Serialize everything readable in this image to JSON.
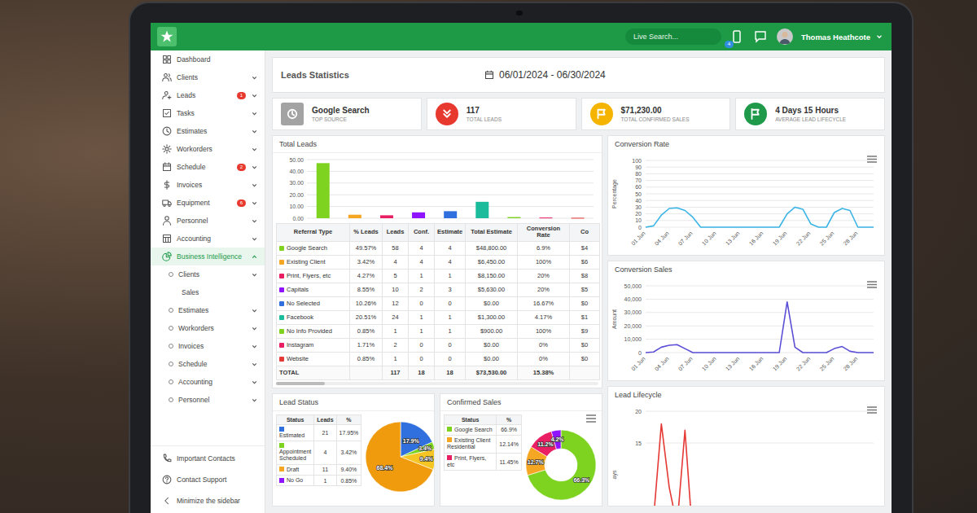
{
  "topbar": {
    "search_placeholder": "Live Search...",
    "phone_badge": "4",
    "user_name": "Thomas Heathcote"
  },
  "sidebar": {
    "items": [
      {
        "label": "Dashboard",
        "kind": "main",
        "badge": "",
        "expandable": false,
        "selected": false,
        "expanded": false
      },
      {
        "label": "Clients",
        "kind": "main",
        "badge": "",
        "expandable": true,
        "selected": false,
        "expanded": false
      },
      {
        "label": "Leads",
        "kind": "main",
        "badge": "1",
        "expandable": true,
        "selected": false,
        "expanded": false
      },
      {
        "label": "Tasks",
        "kind": "main",
        "badge": "",
        "expandable": true,
        "selected": false,
        "expanded": false
      },
      {
        "label": "Estimates",
        "kind": "main",
        "badge": "",
        "expandable": true,
        "selected": false,
        "expanded": false
      },
      {
        "label": "Workorders",
        "kind": "main",
        "badge": "",
        "expandable": true,
        "selected": false,
        "expanded": false
      },
      {
        "label": "Schedule",
        "kind": "main",
        "badge": "2",
        "expandable": true,
        "selected": false,
        "expanded": false
      },
      {
        "label": "Invoices",
        "kind": "main",
        "badge": "",
        "expandable": true,
        "selected": false,
        "expanded": false
      },
      {
        "label": "Equipment",
        "kind": "main",
        "badge": "6",
        "expandable": true,
        "selected": false,
        "expanded": false
      },
      {
        "label": "Personnel",
        "kind": "main",
        "badge": "",
        "expandable": true,
        "selected": false,
        "expanded": false
      },
      {
        "label": "Accounting",
        "kind": "main",
        "badge": "",
        "expandable": true,
        "selected": false,
        "expanded": false
      },
      {
        "label": "Business Intelligence",
        "kind": "main",
        "badge": "",
        "expandable": true,
        "selected": true,
        "expanded": true
      },
      {
        "label": "Clients",
        "kind": "sub",
        "badge": "",
        "expandable": true,
        "selected": false,
        "expanded": false
      },
      {
        "label": "Sales",
        "kind": "subsub",
        "badge": "",
        "expandable": false,
        "selected": false,
        "expanded": false
      },
      {
        "label": "Estimates",
        "kind": "sub",
        "badge": "",
        "expandable": true,
        "selected": false,
        "expanded": false
      },
      {
        "label": "Workorders",
        "kind": "sub",
        "badge": "",
        "expandable": true,
        "selected": false,
        "expanded": false
      },
      {
        "label": "Invoices",
        "kind": "sub",
        "badge": "",
        "expandable": true,
        "selected": false,
        "expanded": false
      },
      {
        "label": "Schedule",
        "kind": "sub",
        "badge": "",
        "expandable": true,
        "selected": false,
        "expanded": false
      },
      {
        "label": "Accounting",
        "kind": "sub",
        "badge": "",
        "expandable": true,
        "selected": false,
        "expanded": false
      },
      {
        "label": "Personnel",
        "kind": "sub",
        "badge": "",
        "expandable": true,
        "selected": false,
        "expanded": false
      }
    ],
    "footer": [
      {
        "label": "Important Contacts"
      },
      {
        "label": "Contact Support"
      },
      {
        "label": "Minimize the sidebar"
      }
    ]
  },
  "header": {
    "title": "Leads Statistics",
    "date_range": "06/01/2024 - 06/30/2024"
  },
  "stats": [
    {
      "value": "Google Search",
      "caption": "TOP SOURCE",
      "color": "#a3a3a3"
    },
    {
      "value": "117",
      "caption": "TOTAL LEADS",
      "color": "#e8392f"
    },
    {
      "value": "$71,230.00",
      "caption": "TOTAL CONFIRMED SALES",
      "color": "#f5b400"
    },
    {
      "value": "4 Days 15 Hours",
      "caption": "AVERAGE LEAD LIFECYCLE",
      "color": "#1e9a4a"
    }
  ],
  "total_leads": {
    "title": "Total Leads",
    "y_ticks": [
      "50.00",
      "40.00",
      "30.00",
      "20.00",
      "10.00",
      "0.00"
    ],
    "bars": [
      {
        "value": 47,
        "color": "#7ed321"
      },
      {
        "value": 3,
        "color": "#f5a623"
      },
      {
        "value": 2.5,
        "color": "#e91e63"
      },
      {
        "value": 5,
        "color": "#9013fe"
      },
      {
        "value": 6,
        "color": "#2f6fde"
      },
      {
        "value": 14,
        "color": "#1abc9c"
      },
      {
        "value": 1,
        "color": "#7ed321"
      },
      {
        "value": 0.6,
        "color": "#e91e63"
      },
      {
        "value": 0.4,
        "color": "#e53935"
      }
    ]
  },
  "table": {
    "columns": [
      "Referral Type",
      "% Leads",
      "Leads",
      "Conf.",
      "Estimate",
      "Total Estimate",
      "Conversion Rate",
      "Co"
    ],
    "rows": [
      {
        "color": "#7ed321",
        "cells": [
          "Google Search",
          "49.57%",
          "58",
          "4",
          "4",
          "$48,800.00",
          "6.9%",
          "$4"
        ]
      },
      {
        "color": "#f5a623",
        "cells": [
          "Existing Client",
          "3.42%",
          "4",
          "4",
          "4",
          "$6,450.00",
          "100%",
          "$6"
        ]
      },
      {
        "color": "#e91e63",
        "cells": [
          "Print, Flyers, etc",
          "4.27%",
          "5",
          "1",
          "1",
          "$8,150.00",
          "20%",
          "$8"
        ]
      },
      {
        "color": "#9013fe",
        "cells": [
          "Capitals",
          "8.55%",
          "10",
          "2",
          "3",
          "$5,630.00",
          "20%",
          "$5"
        ]
      },
      {
        "color": "#2f6fde",
        "cells": [
          "No Selected",
          "10.26%",
          "12",
          "0",
          "0",
          "$0.00",
          "16.67%",
          "$0"
        ]
      },
      {
        "color": "#1abc9c",
        "cells": [
          "Facebook",
          "20.51%",
          "24",
          "1",
          "1",
          "$1,300.00",
          "4.17%",
          "$1"
        ]
      },
      {
        "color": "#7ed321",
        "cells": [
          "No Info Provided",
          "0.85%",
          "1",
          "1",
          "1",
          "$900.00",
          "100%",
          "$9"
        ]
      },
      {
        "color": "#e91e63",
        "cells": [
          "Instagram",
          "1.71%",
          "2",
          "0",
          "0",
          "$0.00",
          "0%",
          "$0"
        ]
      },
      {
        "color": "#e53935",
        "cells": [
          "Website",
          "0.85%",
          "1",
          "0",
          "0",
          "$0.00",
          "0%",
          "$0"
        ]
      }
    ],
    "total": [
      "TOTAL",
      "",
      "117",
      "18",
      "18",
      "$73,530.00",
      "15.38%",
      ""
    ]
  },
  "lead_status": {
    "title": "Lead Status",
    "columns": [
      "Status",
      "Leads",
      "%"
    ],
    "rows": [
      {
        "label": "Estimated",
        "leads": "21",
        "percent": "17.95%",
        "color": "#2f6fde"
      },
      {
        "label": "Appointment Scheduled",
        "leads": "4",
        "percent": "3.42%",
        "color": "#7ed321"
      },
      {
        "label": "Draft",
        "leads": "11",
        "percent": "9.40%",
        "color": "#f5a623"
      },
      {
        "label": "No Go",
        "leads": "1",
        "percent": "0.85%",
        "color": "#9013fe"
      }
    ],
    "pie": [
      {
        "value": 17.9,
        "label": "17.9%",
        "color": "#2f6fde"
      },
      {
        "value": 3.4,
        "label": "3.4%",
        "color": "#7ed321"
      },
      {
        "value": 9.4,
        "label": "9.4%",
        "color": "#f5c623"
      },
      {
        "value": 68.4,
        "label": "68.4%",
        "color": "#f09a0e"
      }
    ]
  },
  "confirmed_sales": {
    "title": "Confirmed Sales",
    "columns": [
      "Status",
      "%"
    ],
    "rows": [
      {
        "label": "Google Search",
        "percent": "66.9%",
        "color": "#7ed321"
      },
      {
        "label": "Existing Client Residential",
        "percent": "12.14%",
        "color": "#f5a623"
      },
      {
        "label": "Print, Flyers, etc",
        "percent": "11.45%",
        "color": "#e91e63"
      }
    ],
    "pie": [
      {
        "value": 66.3,
        "label": "66.3%",
        "color": "#7ed321"
      },
      {
        "value": 12.7,
        "label": "12.7%",
        "color": "#f5a623"
      },
      {
        "value": 11.2,
        "label": "11.2%",
        "color": "#e91e63"
      },
      {
        "value": 4.2,
        "label": "4.2%",
        "color": "#9013fe"
      }
    ]
  },
  "conversion_rate": {
    "title": "Conversion Rate",
    "y_title": "Percentage",
    "y_ticks": [
      "100",
      "90",
      "80",
      "70",
      "60",
      "50",
      "40",
      "30",
      "20",
      "10",
      "0"
    ],
    "x_labels": [
      "01 Jun",
      "04 Jun",
      "07 Jun",
      "10 Jun",
      "13 Jun",
      "16 Jun",
      "19 Jun",
      "22 Jun",
      "25 Jun",
      "28 Jun"
    ],
    "series": [
      {
        "color": "#3bb4e6",
        "values": [
          0,
          2,
          18,
          28,
          29,
          25,
          15,
          0,
          0,
          0,
          0,
          0,
          0,
          0,
          0,
          0,
          0,
          0,
          20,
          30,
          27,
          5,
          0,
          0,
          22,
          28,
          25,
          0,
          0,
          0
        ]
      }
    ]
  },
  "conversion_sales": {
    "title": "Conversion Sales",
    "y_title": "Amount",
    "y_ticks": [
      "50,000",
      "40,000",
      "30,000",
      "20,000",
      "10,000",
      "0"
    ],
    "x_labels": [
      "01 Jun",
      "04 Jun",
      "07 Jun",
      "10 Jun",
      "13 Jun",
      "16 Jun",
      "19 Jun",
      "22 Jun",
      "25 Jun",
      "28 Jun"
    ],
    "series": [
      {
        "color": "#5b4fd6",
        "values": [
          0,
          500,
          4000,
          5500,
          6000,
          3000,
          0,
          0,
          0,
          0,
          0,
          0,
          0,
          0,
          0,
          0,
          0,
          0,
          38000,
          4000,
          0,
          0,
          0,
          0,
          3000,
          4500,
          1000,
          0,
          0,
          0
        ]
      }
    ]
  },
  "lead_lifecycle": {
    "title": "Lead Lifecycle",
    "y_title": "ays",
    "y_ticks": [
      "20",
      "15"
    ],
    "x_labels": [],
    "series": [
      {
        "color": "#e53935",
        "values": [
          0,
          3,
          18,
          8,
          2,
          17,
          0,
          0,
          0,
          0,
          0,
          0,
          0,
          0,
          0,
          0,
          0,
          0,
          0,
          0,
          0,
          0,
          0,
          0,
          0,
          0,
          0,
          0,
          0,
          0
        ]
      }
    ]
  }
}
